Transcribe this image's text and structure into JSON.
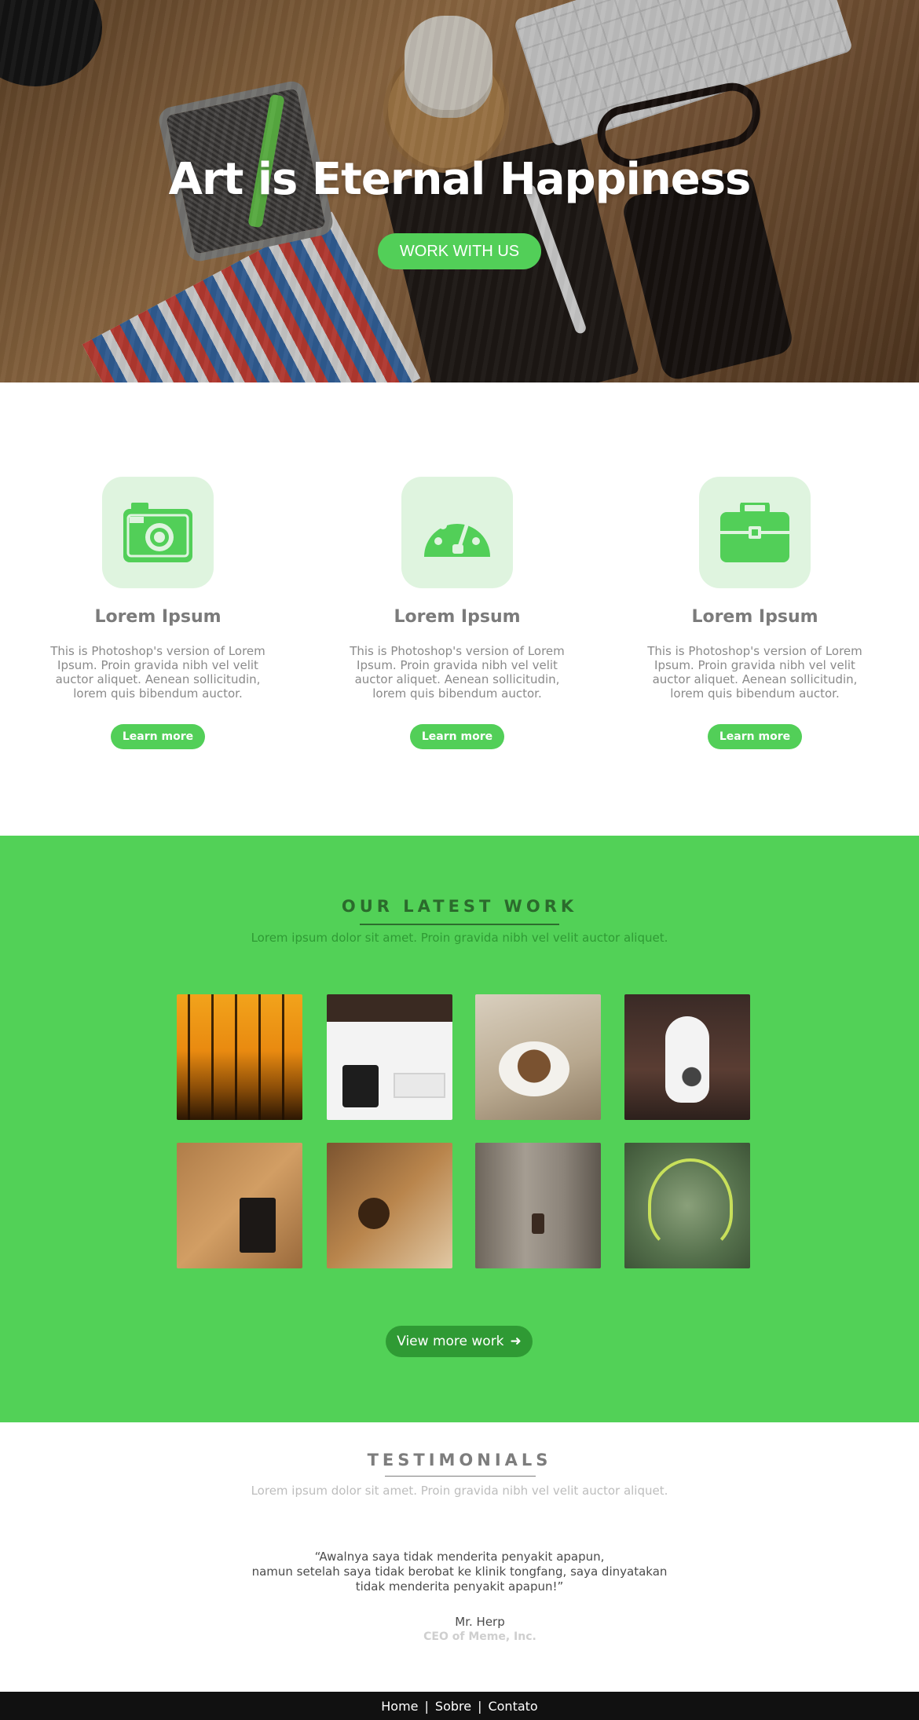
{
  "hero": {
    "title": "Art is Eternal Happiness",
    "cta_label": "WORK WITH US"
  },
  "features": [
    {
      "icon": "camera-icon",
      "title": "Lorem Ipsum",
      "text": "This is Photoshop's version  of Lorem Ipsum. Proin gravida nibh vel velit auctor aliquet. Aenean sollicitudin, lorem quis bibendum auctor.",
      "button": "Learn more"
    },
    {
      "icon": "speedometer-icon",
      "title": "Lorem Ipsum",
      "text": "This is Photoshop's version  of Lorem Ipsum. Proin gravida nibh vel velit auctor aliquet. Aenean sollicitudin, lorem quis bibendum auctor.",
      "button": "Learn more"
    },
    {
      "icon": "briefcase-icon",
      "title": "Lorem Ipsum",
      "text": "This is Photoshop's version  of Lorem Ipsum. Proin gravida nibh vel velit auctor aliquet. Aenean sollicitudin, lorem quis bibendum auctor.",
      "button": "Learn more"
    }
  ],
  "work": {
    "title": "OUR LATEST WORK",
    "subtitle": "Lorem ipsum dolor sit amet. Proin gravida nibh vel velit auctor aliquet.",
    "thumbnails": [
      "sunset-trees",
      "desk-workspace",
      "cake-coffee",
      "kitten",
      "desk-top-view",
      "food-table",
      "wooden-plank",
      "ladybug-grass"
    ],
    "more_label": "View more work",
    "more_icon": "arrow-right-icon"
  },
  "testimonials": {
    "title": "TESTIMONIALS",
    "subtitle": "Lorem ipsum dolor sit amet. Proin gravida nibh vel velit auctor aliquet.",
    "quote_lines": [
      "“Awalnya saya tidak menderita penyakit apapun,",
      "namun setelah saya tidak berobat ke klinik tongfang, saya dinyatakan",
      "tidak menderita penyakit apapun!”"
    ],
    "author": "Mr. Herp",
    "role": "CEO of Meme, Inc."
  },
  "footer": {
    "links": [
      "Home",
      "Sobre",
      "Contato"
    ],
    "separator": "|"
  },
  "colors": {
    "accent": "#52cf58",
    "accent_dark": "#2f9a34",
    "icon_bg": "#dff4df",
    "footer_bg": "#111111"
  }
}
